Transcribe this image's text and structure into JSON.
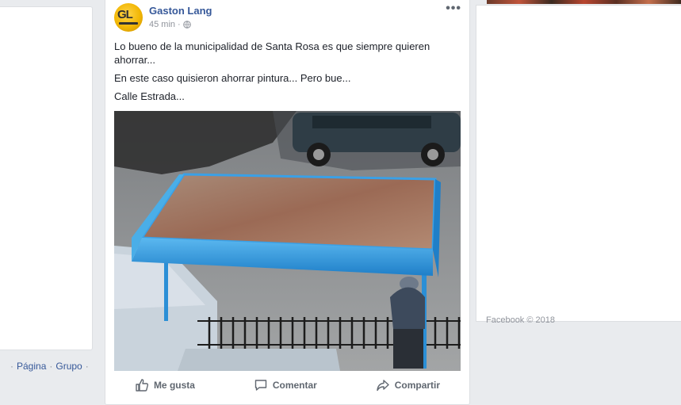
{
  "left_links": {
    "page": "Página",
    "group": "Grupo"
  },
  "post": {
    "author": "Gaston Lang",
    "avatar_text": "GL",
    "time": "45 min",
    "more": "•••",
    "paragraphs": [
      "Lo bueno de la municipalidad de Santa Rosa es que siempre quieren ahorrar...",
      "En este caso quisieron ahorrar pintura... Pero bue...",
      "Calle Estrada..."
    ],
    "actions": {
      "like": "Me gusta",
      "comment": "Comentar",
      "share": "Compartir"
    }
  },
  "right": {
    "footer": "Facebook © 2018"
  },
  "colors": {
    "link": "#365899",
    "meta": "#90949c",
    "background": "#e9ebee",
    "shelter_blue": "#2b8fd6"
  },
  "icons": {
    "globe": "globe-icon",
    "like": "thumbs-up-icon",
    "comment": "comment-icon",
    "share": "share-arrow-icon"
  }
}
